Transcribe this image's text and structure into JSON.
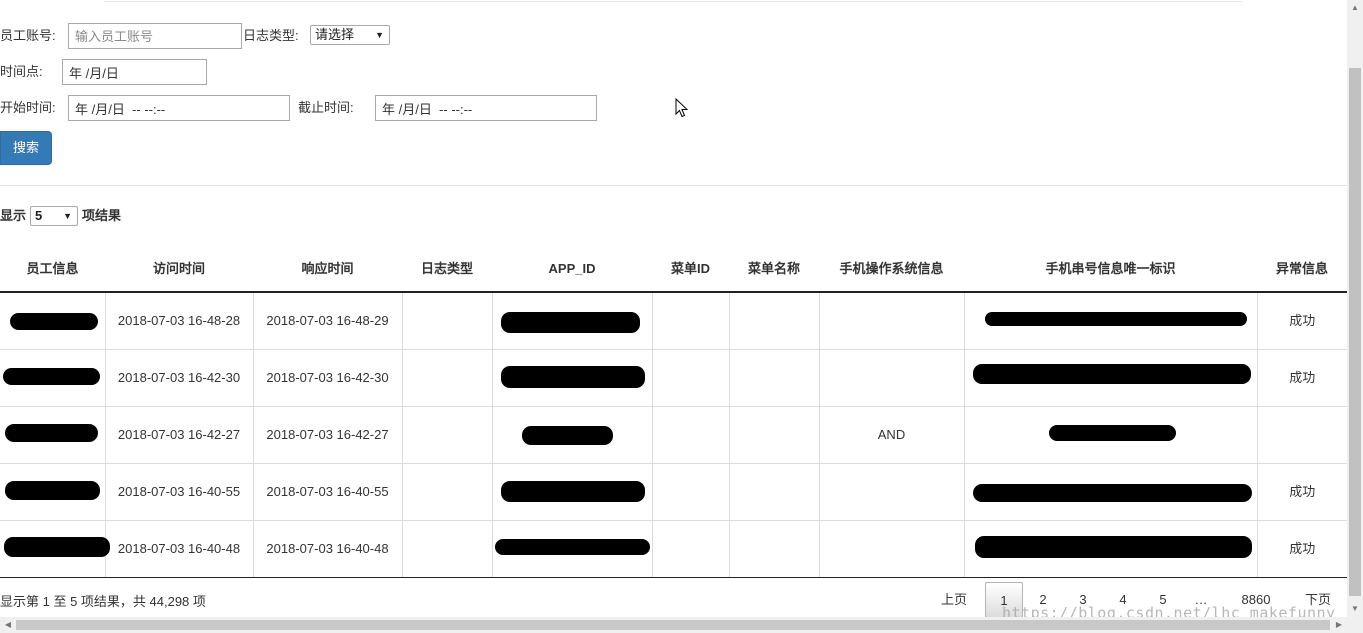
{
  "filters": {
    "employee_label": "员工账号:",
    "employee_placeholder": "输入员工账号",
    "log_type_label": "日志类型:",
    "log_type_selected": "请选择",
    "time_point_label": "时间点:",
    "time_point_value": "年 /月/日",
    "start_label": "开始时间:",
    "start_value": "年 /月/日  -- --:--",
    "end_label": "截止时间:",
    "end_value": "年 /月/日  -- --:--",
    "search_label": "搜索"
  },
  "length": {
    "prefix": "显示",
    "selected": "5",
    "suffix": "项结果"
  },
  "table": {
    "headers": [
      "员工信息",
      "访问时间",
      "响应时间",
      "日志类型",
      "APP_ID",
      "菜单ID",
      "菜单名称",
      "手机操作系统信息",
      "手机串号信息唯一标识",
      "异常信息"
    ],
    "rows": [
      {
        "visit": "2018-07-03 16-48-28",
        "response": "2018-07-03 16-48-29",
        "os": "",
        "result": "成功"
      },
      {
        "visit": "2018-07-03 16-42-30",
        "response": "2018-07-03 16-42-30",
        "os": "",
        "result": "成功"
      },
      {
        "visit": "2018-07-03 16-42-27",
        "response": "2018-07-03 16-42-27",
        "os": "AND",
        "result": ""
      },
      {
        "visit": "2018-07-03 16-40-55",
        "response": "2018-07-03 16-40-55",
        "os": "",
        "result": "成功"
      },
      {
        "visit": "2018-07-03 16-40-48",
        "response": "2018-07-03 16-40-48",
        "os": "",
        "result": "成功"
      }
    ]
  },
  "footer": {
    "info": "显示第 1 至 5 项结果，共 44,298 项",
    "prev": "上页",
    "pages": [
      "1",
      "2",
      "3",
      "4",
      "5"
    ],
    "ellipsis": "…",
    "last_page": "8860",
    "next": "下页",
    "current_page": "1"
  },
  "watermark": "https://blog.csdn.net/lhc_makefunny",
  "icons": {
    "select_arrow": "▼",
    "scroll_up": "▲",
    "scroll_down": "▼",
    "scroll_left": "◀",
    "scroll_right": "▶"
  },
  "colors": {
    "primary": "#337ab7",
    "border": "#dcdcdc",
    "text": "#333333"
  }
}
